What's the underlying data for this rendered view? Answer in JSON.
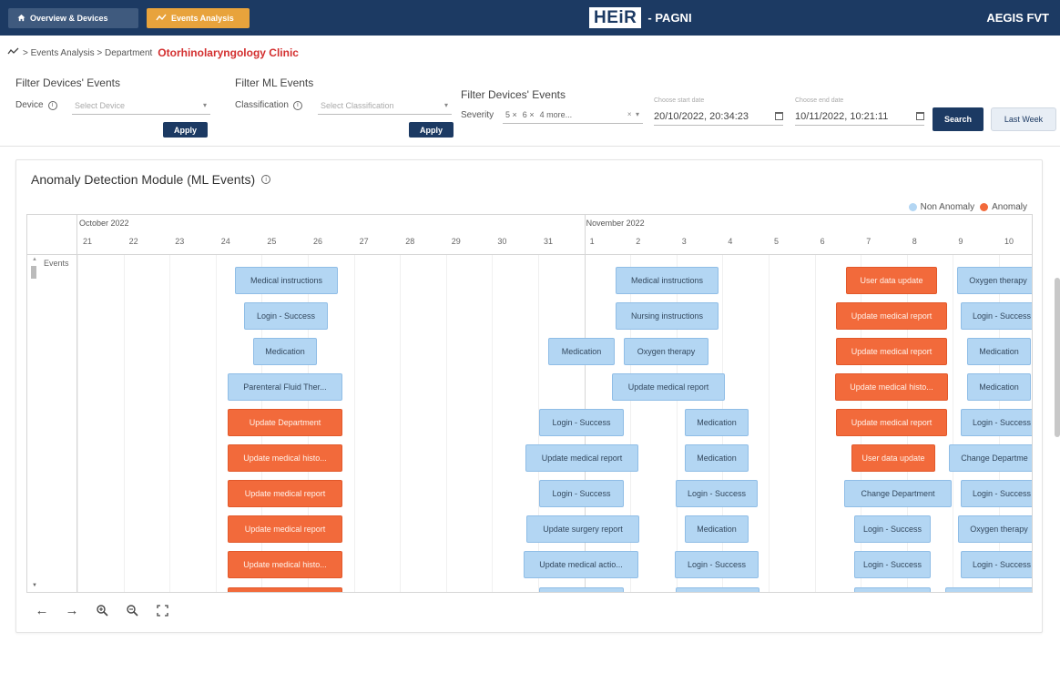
{
  "navbar": {
    "overview_label": "Overview & Devices",
    "events_label": "Events Analysis",
    "brand_logo": "HEiR",
    "brand_sub": "- PAGNI",
    "user": "AEGIS FVT"
  },
  "breadcrumb": {
    "trail": "> Events Analysis > Department",
    "department": "Otorhinolaryngology Clinic"
  },
  "filters": {
    "devices": {
      "title": "Filter Devices' Events",
      "label": "Device",
      "placeholder": "Select Device",
      "apply": "Apply"
    },
    "ml": {
      "title": "Filter ML Events",
      "label": "Classification",
      "placeholder": "Select Classification",
      "apply": "Apply"
    },
    "severity": {
      "title": "Filter Devices' Events",
      "label": "Severity",
      "chip1": "5",
      "chip2": "6",
      "more": "4 more..."
    },
    "start": {
      "label": "Choose start date",
      "value": "20/10/2022, 20:34:23"
    },
    "end": {
      "label": "Choose end date",
      "value": "10/11/2022, 10:21:11"
    },
    "search": "Search",
    "last_week": "Last Week"
  },
  "module": {
    "title": "Anomaly Detection Module (ML Events)",
    "legend_non": "Non Anomaly",
    "legend_ano": "Anomaly",
    "colors": {
      "non_anomaly": "#b3d6f3",
      "anomaly": "#f26a3b"
    }
  },
  "timeline": {
    "months": [
      "October 2022",
      "November 2022"
    ],
    "days": [
      "21",
      "22",
      "23",
      "24",
      "25",
      "26",
      "27",
      "28",
      "29",
      "30",
      "31",
      "1",
      "2",
      "3",
      "4",
      "5",
      "6",
      "7",
      "8",
      "9",
      "10"
    ],
    "group": "Events"
  },
  "events": [
    {
      "label": "Medical instructions",
      "anomaly": false
    },
    {
      "label": "Login - Success",
      "anomaly": false
    },
    {
      "label": "Medication",
      "anomaly": false
    },
    {
      "label": "Parenteral Fluid Ther...",
      "anomaly": false
    },
    {
      "label": "Update Department",
      "anomaly": true
    },
    {
      "label": "Update medical histo...",
      "anomaly": true
    },
    {
      "label": "Update medical report",
      "anomaly": true
    },
    {
      "label": "Update medical report",
      "anomaly": true
    },
    {
      "label": "Update medical histo...",
      "anomaly": true
    },
    {
      "label": "Medication",
      "anomaly": false
    },
    {
      "label": "Login - Success",
      "anomaly": false
    },
    {
      "label": "Update medical report",
      "anomaly": false
    },
    {
      "label": "Login - Success",
      "anomaly": false
    },
    {
      "label": "Update surgery report",
      "anomaly": false
    },
    {
      "label": "Update medical actio...",
      "anomaly": false
    },
    {
      "label": "Medical instructions",
      "anomaly": false
    },
    {
      "label": "Nursing instructions",
      "anomaly": false
    },
    {
      "label": "Oxygen therapy",
      "anomaly": false
    },
    {
      "label": "Update medical report",
      "anomaly": false
    },
    {
      "label": "Medication",
      "anomaly": false
    },
    {
      "label": "Medication",
      "anomaly": false
    },
    {
      "label": "Login - Success",
      "anomaly": false
    },
    {
      "label": "Medication",
      "anomaly": false
    },
    {
      "label": "Login - Success",
      "anomaly": false
    },
    {
      "label": "User data update",
      "anomaly": true
    },
    {
      "label": "Update medical report",
      "anomaly": true
    },
    {
      "label": "Update medical report",
      "anomaly": true
    },
    {
      "label": "Update medical histo...",
      "anomaly": true
    },
    {
      "label": "Update medical report",
      "anomaly": true
    },
    {
      "label": "User data update",
      "anomaly": true
    },
    {
      "label": "Change Department",
      "anomaly": false
    },
    {
      "label": "Login - Success",
      "anomaly": false
    },
    {
      "label": "Login - Success",
      "anomaly": false
    },
    {
      "label": "Oxygen therapy",
      "anomaly": false
    },
    {
      "label": "Login - Success",
      "anomaly": false
    },
    {
      "label": "Medication",
      "anomaly": false
    },
    {
      "label": "Medication",
      "anomaly": false
    },
    {
      "label": "Login - Success",
      "anomaly": false
    },
    {
      "label": "Change Departme",
      "anomaly": false
    },
    {
      "label": "Login - Success",
      "anomaly": false
    },
    {
      "label": "Oxygen therapy",
      "anomaly": false
    },
    {
      "label": "Login - Success",
      "anomaly": false
    }
  ]
}
